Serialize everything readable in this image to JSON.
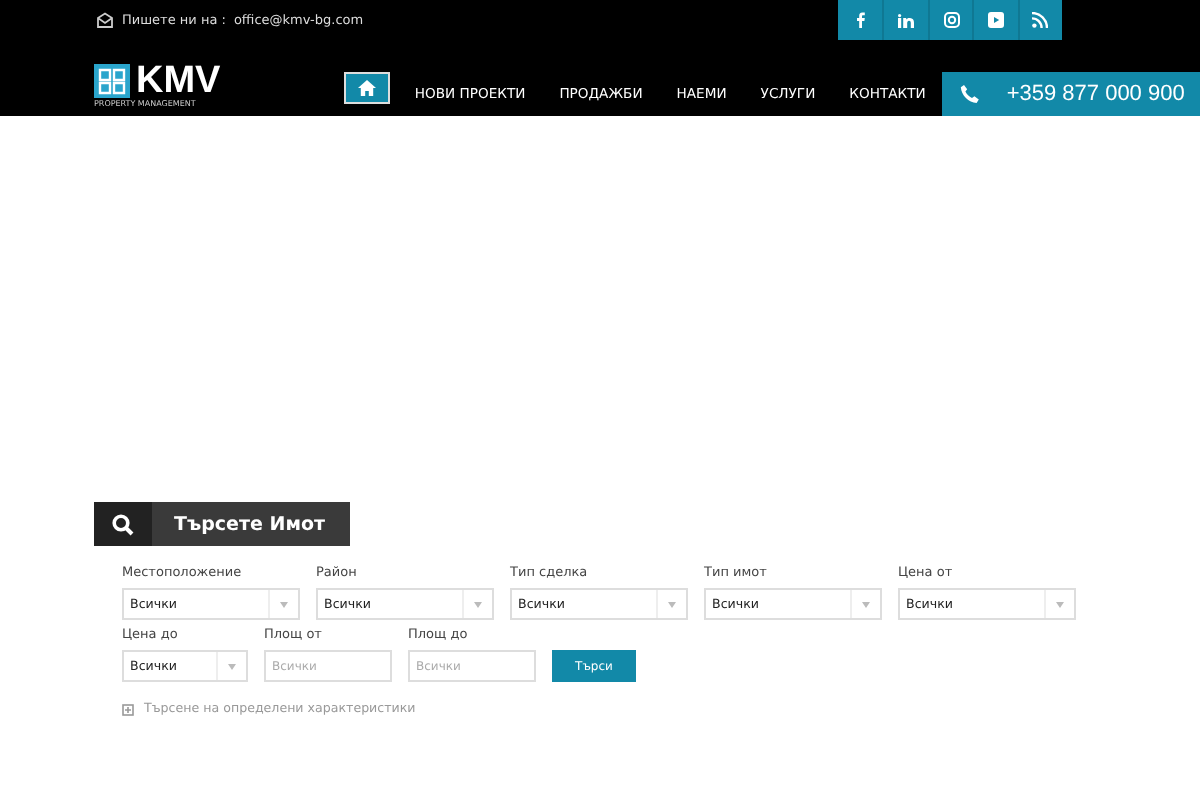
{
  "topbar": {
    "email_label": "Пишете ни на :",
    "email": "office@kmv-bg.com"
  },
  "logo": {
    "name": "KMV",
    "tagline": "PROPERTY MANAGEMENT"
  },
  "nav": [
    {
      "kind": "home",
      "selected": true
    },
    {
      "kind": "text",
      "label": "НОВИ ПРОЕКТИ",
      "selected": false
    },
    {
      "kind": "text",
      "label": "ПРОДАЖБИ",
      "selected": false
    },
    {
      "kind": "text",
      "label": "НАЕМИ",
      "selected": false
    },
    {
      "kind": "text",
      "label": "УСЛУГИ",
      "selected": false
    },
    {
      "kind": "text",
      "label": "КОНТАКТИ",
      "selected": false
    }
  ],
  "phone": "+359 877 000 900",
  "search": {
    "title": "Търсете Имот",
    "fields": [
      {
        "kind": "select",
        "label": "Местоположение",
        "value": "Всички"
      },
      {
        "kind": "select",
        "label": "Район",
        "value": "Всички"
      },
      {
        "kind": "select",
        "label": "Тип сделка",
        "value": "Всички"
      },
      {
        "kind": "select",
        "label": "Тип имот",
        "value": "Всички"
      },
      {
        "kind": "select",
        "label": "Цена от",
        "value": "Всички"
      },
      {
        "kind": "select",
        "label": "Цена до",
        "value": "Всички"
      },
      {
        "kind": "input",
        "label": "Площ от",
        "placeholder": "Всички"
      },
      {
        "kind": "input",
        "label": "Площ до",
        "placeholder": "Всички"
      }
    ],
    "button": "Търси",
    "advanced": "Търсене на определени характеристики"
  }
}
